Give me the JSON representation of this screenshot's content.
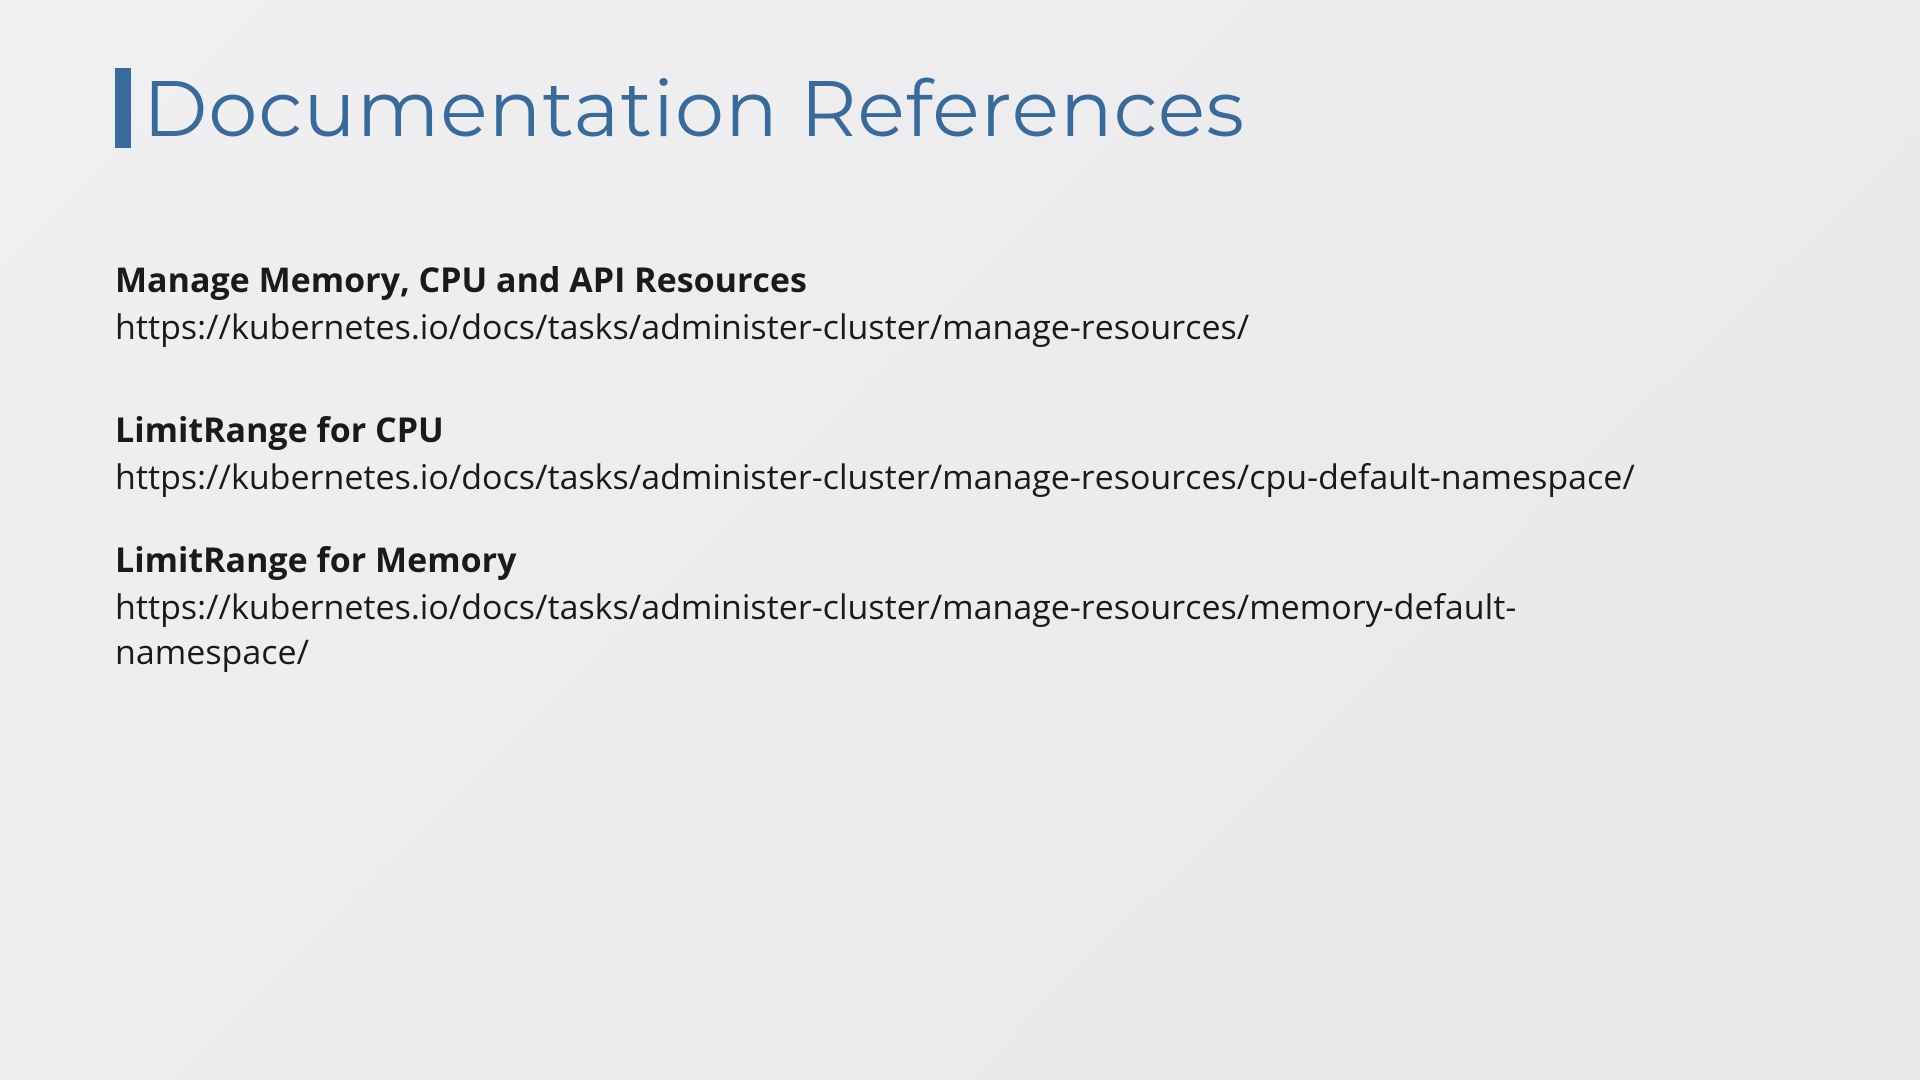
{
  "title": "Documentation References",
  "references": [
    {
      "title": "Manage Memory, CPU and API Resources",
      "url": "https://kubernetes.io/docs/tasks/administer-cluster/manage-resources/"
    },
    {
      "title": "LimitRange for CPU",
      "url": "https://kubernetes.io/docs/tasks/administer-cluster/manage-resources/cpu-default-namespace/"
    },
    {
      "title": "LimitRange for Memory",
      "url": "https://kubernetes.io/docs/tasks/administer-cluster/manage-resources/memory-default-namespace/"
    }
  ]
}
